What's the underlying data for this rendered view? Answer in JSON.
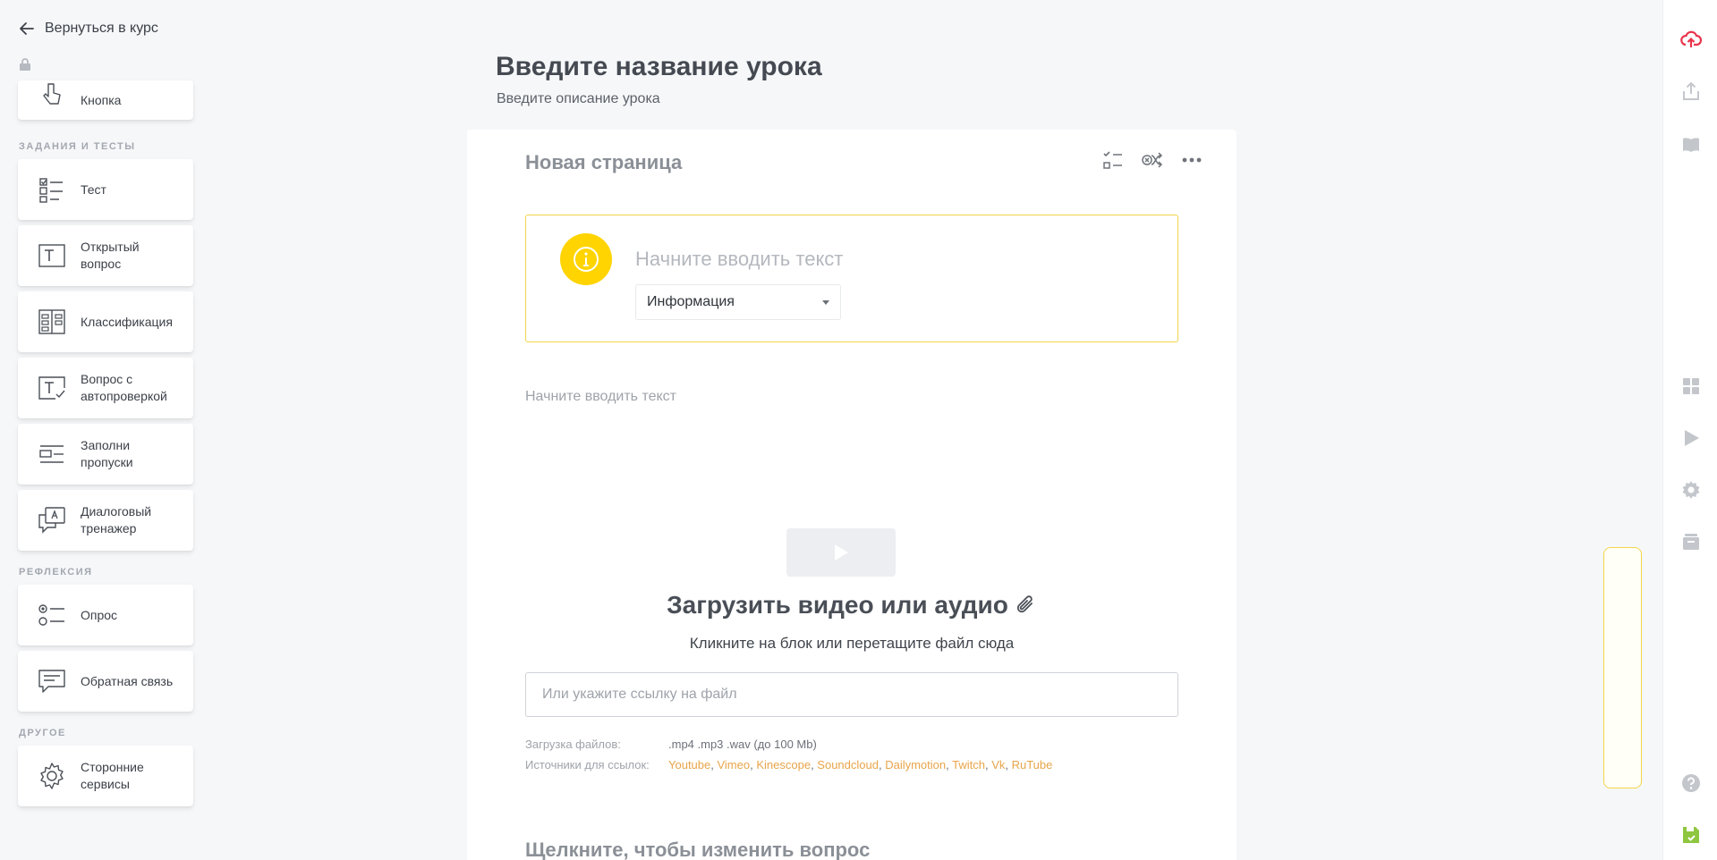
{
  "nav": {
    "back_label": "Вернуться в курс"
  },
  "palette": {
    "top_partial_item": "Кнопка",
    "sections": [
      {
        "title": "ЗАДАНИЯ И ТЕСТЫ",
        "items": [
          {
            "label": "Тест",
            "icon": "checklist-icon"
          },
          {
            "label": "Открытый вопрос",
            "icon": "text-box-icon"
          },
          {
            "label": "Классификация",
            "icon": "classification-icon"
          },
          {
            "label": "Вопрос с автопроверкой",
            "icon": "autocheck-icon"
          },
          {
            "label": "Заполни пропуски",
            "icon": "fill-gaps-icon"
          },
          {
            "label": "Диалоговый тренажер",
            "icon": "dialog-icon"
          }
        ]
      },
      {
        "title": "РЕФЛЕКСИЯ",
        "items": [
          {
            "label": "Опрос",
            "icon": "poll-icon"
          },
          {
            "label": "Обратная связь",
            "icon": "feedback-icon"
          }
        ]
      },
      {
        "title": "ДРУГОЕ",
        "items": [
          {
            "label": "Сторонние сервисы",
            "icon": "gear-icon"
          }
        ]
      }
    ]
  },
  "lesson": {
    "title": "Введите название урока",
    "description": "Введите описание урока"
  },
  "page": {
    "title": "Новая страница",
    "info_block": {
      "placeholder": "Начните вводить текст",
      "type_selected": "Информация",
      "accent": "#ffd400"
    },
    "text_block": {
      "placeholder": "Начните вводить текст"
    },
    "media_block": {
      "title": "Загрузить видео или аудио",
      "hint": "Кликните на блок или перетащите файл сюда",
      "url_placeholder": "Или укажите ссылку на файл",
      "upload_label": "Загрузка файлов:",
      "upload_formats": ".mp4 .mp3 .wav (до 100 Mb)",
      "sources_label": "Источники для ссылок:",
      "sources": [
        "Youtube",
        "Vimeo",
        "Kinescope",
        "Soundcloud",
        "Dailymotion",
        "Twitch",
        "Vk",
        "RuTube"
      ]
    },
    "question_prompt": "Щелкните, чтобы изменить вопрос"
  },
  "colors": {
    "accent_yellow": "#ffd400",
    "brand_red": "#e8344b",
    "save_green": "#8ec63f",
    "link_orange": "#e8a54a"
  }
}
